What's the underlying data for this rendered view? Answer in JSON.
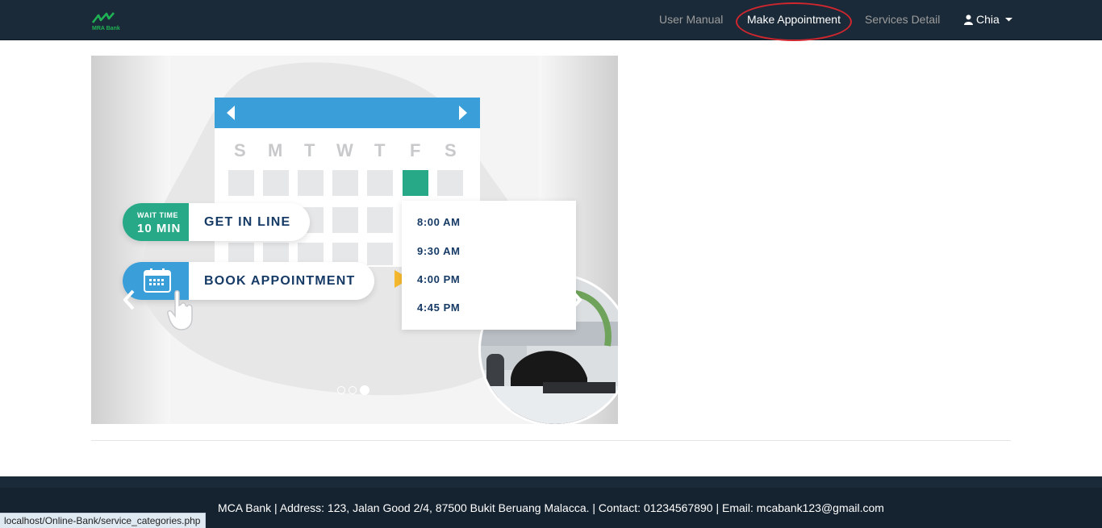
{
  "brand": {
    "name": "MRA Bank",
    "logo_icon": "bank-logo-icon",
    "accent": "#1fb254"
  },
  "nav": {
    "items": [
      {
        "label": "User Manual"
      },
      {
        "label": "Make Appointment"
      },
      {
        "label": "Services Detail"
      }
    ],
    "user": {
      "name": "Chia",
      "icon": "user-icon",
      "caret": "caret-down-icon"
    }
  },
  "carousel": {
    "weekdays": [
      "S",
      "M",
      "T",
      "W",
      "T",
      "F",
      "S"
    ],
    "wait_badge": {
      "small": "WAIT TIME",
      "big": "10 MIN"
    },
    "get_in_line": "GET IN LINE",
    "book_appointment": "BOOK APPOINTMENT",
    "times": [
      "8:00 AM",
      "9:30 AM",
      "4:00 PM",
      "4:45 PM"
    ],
    "prev_icon": "chevron-left-icon",
    "next_icon": "chevron-right-icon",
    "active_slide": 3,
    "slide_count": 3,
    "colors": {
      "calendar_header": "#3a9fd8",
      "highlight_day": "#27a887",
      "pointer": "#f5b82e"
    }
  },
  "footer": {
    "text": "MCA Bank | Address: 123, Jalan Good 2/4, 87500 Bukit Beruang Malacca. | Contact: 01234567890 | Email: mcabank123@gmail.com"
  },
  "status_bar": {
    "url": "localhost/Online-Bank/service_categories.php"
  }
}
